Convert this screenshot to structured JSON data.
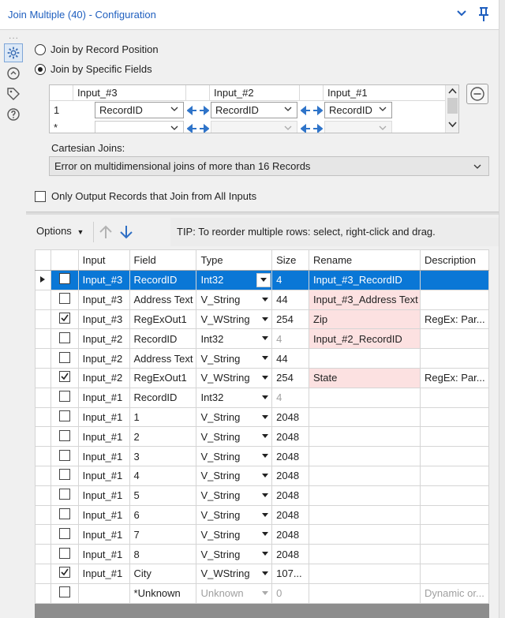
{
  "window": {
    "title": "Join Multiple (40) - Configuration"
  },
  "sidebar": {
    "dots": "...",
    "icons": [
      "gear-icon",
      "annotation-icon",
      "tag-icon",
      "help-icon"
    ]
  },
  "join_mode": {
    "by_position_label": "Join by Record Position",
    "by_fields_label": "Join by Specific Fields",
    "selected": "Join by Specific Fields"
  },
  "join_grid": {
    "columns": [
      "Input_#3",
      "Input_#2",
      "Input_#1"
    ],
    "rows": [
      {
        "num": "1",
        "values": [
          "RecordID",
          "RecordID",
          "RecordID"
        ]
      },
      {
        "num": "*",
        "values": [
          "",
          "",
          ""
        ]
      }
    ]
  },
  "cartesian": {
    "label": "Cartesian Joins:",
    "value": "Error on multidimensional joins of more than 16 Records"
  },
  "only_output": {
    "label": "Only Output Records that Join from All Inputs",
    "checked": false
  },
  "toolbar": {
    "options_label": "Options",
    "tip": "TIP: To reorder multiple rows: select, right-click and drag."
  },
  "field_grid": {
    "headers": [
      "Input",
      "Field",
      "Type",
      "Size",
      "Rename",
      "Description"
    ],
    "rows": [
      {
        "checked": false,
        "input": "Input_#3",
        "field": "RecordID",
        "type": "Int32",
        "size": "4",
        "rename": "Input_#3_RecordID",
        "description": ""
      },
      {
        "checked": false,
        "input": "Input_#3",
        "field": "Address Text",
        "type": "V_String",
        "size": "44",
        "rename": "Input_#3_Address Text",
        "description": ""
      },
      {
        "checked": true,
        "input": "Input_#3",
        "field": "RegExOut1",
        "type": "V_WString",
        "size": "254",
        "rename": "Zip",
        "description": "RegEx: Par..."
      },
      {
        "checked": false,
        "input": "Input_#2",
        "field": "RecordID",
        "type": "Int32",
        "size": "4",
        "rename": "Input_#2_RecordID",
        "description": ""
      },
      {
        "checked": false,
        "input": "Input_#2",
        "field": "Address Text",
        "type": "V_String",
        "size": "44",
        "rename": "",
        "description": ""
      },
      {
        "checked": true,
        "input": "Input_#2",
        "field": "RegExOut1",
        "type": "V_WString",
        "size": "254",
        "rename": "State",
        "description": "RegEx: Par..."
      },
      {
        "checked": false,
        "input": "Input_#1",
        "field": "RecordID",
        "type": "Int32",
        "size": "4",
        "rename": "",
        "description": ""
      },
      {
        "checked": false,
        "input": "Input_#1",
        "field": "1",
        "type": "V_String",
        "size": "2048",
        "rename": "",
        "description": ""
      },
      {
        "checked": false,
        "input": "Input_#1",
        "field": "2",
        "type": "V_String",
        "size": "2048",
        "rename": "",
        "description": ""
      },
      {
        "checked": false,
        "input": "Input_#1",
        "field": "3",
        "type": "V_String",
        "size": "2048",
        "rename": "",
        "description": ""
      },
      {
        "checked": false,
        "input": "Input_#1",
        "field": "4",
        "type": "V_String",
        "size": "2048",
        "rename": "",
        "description": ""
      },
      {
        "checked": false,
        "input": "Input_#1",
        "field": "5",
        "type": "V_String",
        "size": "2048",
        "rename": "",
        "description": ""
      },
      {
        "checked": false,
        "input": "Input_#1",
        "field": "6",
        "type": "V_String",
        "size": "2048",
        "rename": "",
        "description": ""
      },
      {
        "checked": false,
        "input": "Input_#1",
        "field": "7",
        "type": "V_String",
        "size": "2048",
        "rename": "",
        "description": ""
      },
      {
        "checked": false,
        "input": "Input_#1",
        "field": "8",
        "type": "V_String",
        "size": "2048",
        "rename": "",
        "description": ""
      },
      {
        "checked": true,
        "input": "Input_#1",
        "field": "City",
        "type": "V_WString",
        "size": "107...",
        "rename": "",
        "description": ""
      },
      {
        "checked": false,
        "input": "",
        "field": "*Unknown",
        "type": "Unknown",
        "size": "0",
        "rename": "",
        "description": "Dynamic or..."
      }
    ]
  },
  "colors": {
    "title_blue": "#1f5fbf",
    "selection_blue": "#0a77d6",
    "rename_highlight": "#fce1e1"
  }
}
